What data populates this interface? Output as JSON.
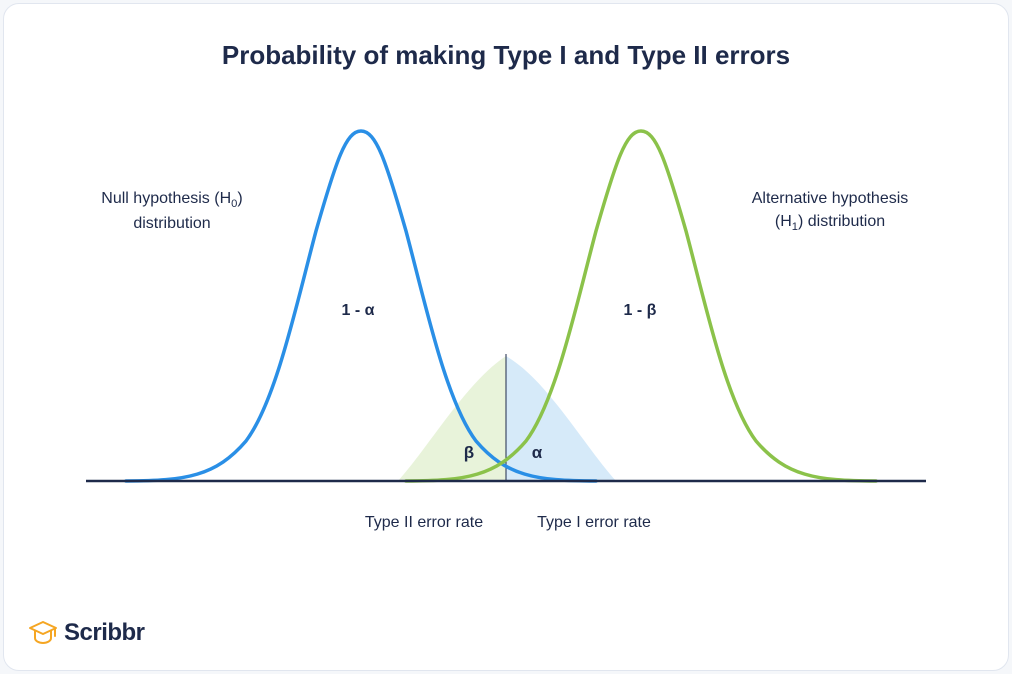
{
  "title": "Probability of making Type I and Type II errors",
  "labels": {
    "null_line1": "Null hypothesis (H",
    "null_sub": "0",
    "null_line2": ")",
    "null_line3": "distribution",
    "alt_line1": "Alternative hypothesis",
    "alt_line2a": "(H",
    "alt_sub": "1",
    "alt_line2b": ") distribution",
    "one_minus_alpha": "1 - α",
    "one_minus_beta": "1 - β",
    "beta_symbol": "β",
    "alpha_symbol": "α",
    "type2": "Type II error rate",
    "type1": "Type I error rate"
  },
  "colors": {
    "null_curve": "#2a8fe6",
    "alt_curve": "#8bc24a",
    "axis": "#1e2a4a",
    "alpha_fill": "#d6eaf9",
    "beta_fill": "#e8f3da"
  },
  "brand": "Scribbr",
  "chart_data": {
    "type": "diagram",
    "description": "Two overlapping normal distributions illustrating Type I (α) and Type II (β) error regions around a decision threshold.",
    "curves": [
      {
        "name": "H0",
        "mean": 0,
        "sd": 1,
        "color": "#2a8fe6"
      },
      {
        "name": "H1",
        "mean": 2.6,
        "sd": 1,
        "color": "#8bc24a"
      }
    ],
    "threshold": 1.3,
    "regions": {
      "alpha": "area under H0 right of threshold",
      "beta": "area under H1 left of threshold"
    },
    "annotations": [
      "1 - α",
      "1 - β",
      "α",
      "β",
      "Type I error rate",
      "Type II error rate"
    ]
  }
}
